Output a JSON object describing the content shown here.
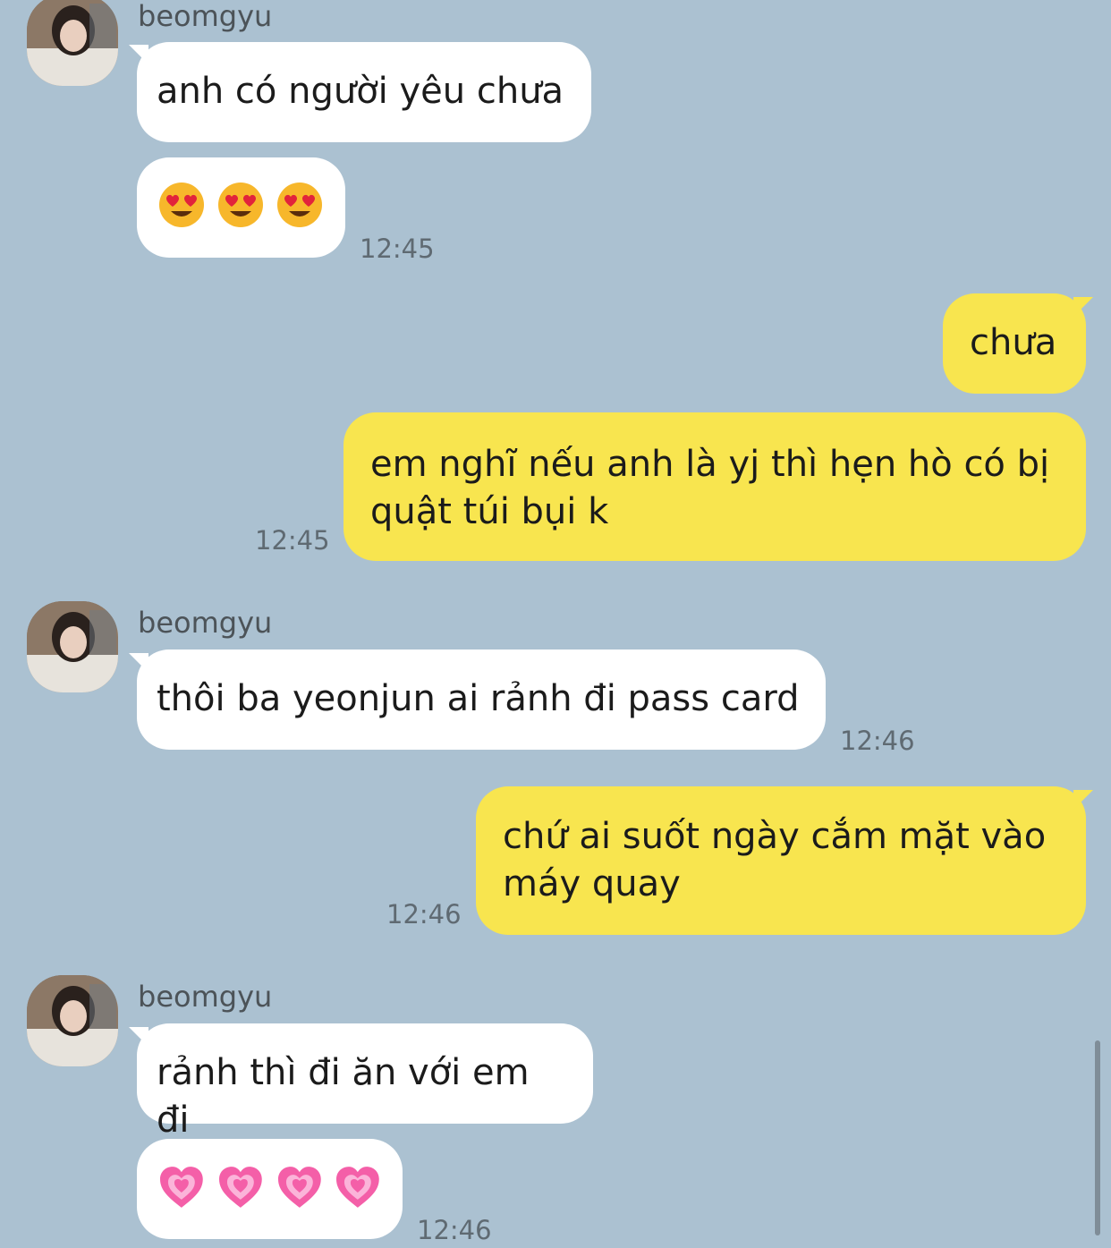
{
  "messages": [
    {
      "sender": "beomgyu",
      "text": "anh có người yêu chưa"
    },
    {
      "emoji": [
        "heart-eyes",
        "heart-eyes",
        "heart-eyes"
      ],
      "time": "12:45"
    },
    {
      "text": "chưa"
    },
    {
      "text_line1": "em nghĩ nếu anh là yj thì hẹn hò có bị",
      "text_line2": "quật túi bụi k",
      "time": "12:45"
    },
    {
      "sender": "beomgyu",
      "text": "thôi ba yeonjun ai rảnh đi pass card",
      "time": "12:46"
    },
    {
      "text_line1": "chứ ai suốt ngày cắm mặt vào",
      "text_line2": "máy quay",
      "time": "12:46"
    },
    {
      "sender": "beomgyu",
      "text": "rảnh thì đi ăn với em đi"
    },
    {
      "emoji": [
        "growing-heart",
        "growing-heart",
        "growing-heart",
        "growing-heart"
      ],
      "time": "12:46"
    }
  ],
  "colors": {
    "background": "#abc1d1",
    "incoming_bubble": "#ffffff",
    "outgoing_bubble": "#f8e54f"
  }
}
